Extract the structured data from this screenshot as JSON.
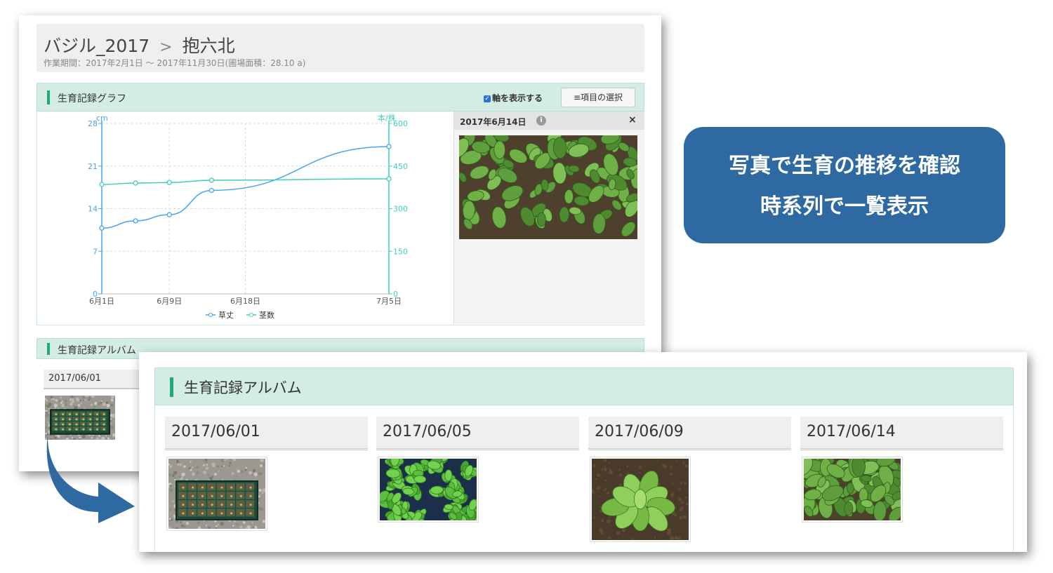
{
  "header": {
    "crumb_parent": "バジル_2017",
    "crumb_separator": ">",
    "crumb_current": "抱六北",
    "period": "作業期間：2017年2月1日 〜 2017年11月30日(圃場面積：28.10 a)"
  },
  "graph_section": {
    "title": "生育記録グラフ",
    "axis_toggle_label": "軸を表示する",
    "select_items_label": "項目の選択",
    "photo_panel": {
      "date": "2017年6月14日",
      "info": "i",
      "close": "×"
    }
  },
  "chart_data": {
    "type": "line",
    "x": [
      "6月1日",
      "6月5日",
      "6月9日",
      "6月14日",
      "7月5日"
    ],
    "x_days": [
      1,
      5,
      9,
      14,
      35
    ],
    "x_ticks": [
      {
        "label": "6月1日",
        "day": 1
      },
      {
        "label": "6月9日",
        "day": 9
      },
      {
        "label": "6月18日",
        "day": 18
      },
      {
        "label": "7月5日",
        "day": 35
      }
    ],
    "series": [
      {
        "name": "草丈",
        "axis": "left",
        "color": "#4aa3f0",
        "values": [
          10.8,
          12,
          13,
          17,
          24.2
        ]
      },
      {
        "name": "茎数",
        "axis": "right",
        "color": "#3fd0b8",
        "values": [
          385,
          390,
          392,
          400,
          405
        ]
      }
    ],
    "y_left": {
      "label": "cm",
      "ticks": [
        0,
        7,
        14,
        21,
        28
      ],
      "ylim": [
        0,
        28
      ]
    },
    "y_right": {
      "label": "本/株",
      "ticks": [
        0,
        150,
        300,
        450,
        600
      ],
      "ylim": [
        0,
        600
      ]
    },
    "grid": true,
    "legend": "bottom-center"
  },
  "album_back": {
    "title": "生育記録アルバム",
    "first_date": "2017/06/01"
  },
  "album_front": {
    "title": "生育記録アルバム",
    "items": [
      {
        "date": "2017/06/01",
        "photo": "seedling-tray"
      },
      {
        "date": "2017/06/05",
        "photo": "potted-seedlings"
      },
      {
        "date": "2017/06/09",
        "photo": "basil-closeup"
      },
      {
        "date": "2017/06/14",
        "photo": "basil-field"
      }
    ]
  },
  "callout": {
    "line1": "写真で生育の推移を確認",
    "line2": "時系列で一覧表示"
  },
  "colors": {
    "accent": "#1fa97d",
    "section_bg": "#d3ede5",
    "callout_bg": "#2e6aa1",
    "arrow": "#2e6aa1"
  }
}
